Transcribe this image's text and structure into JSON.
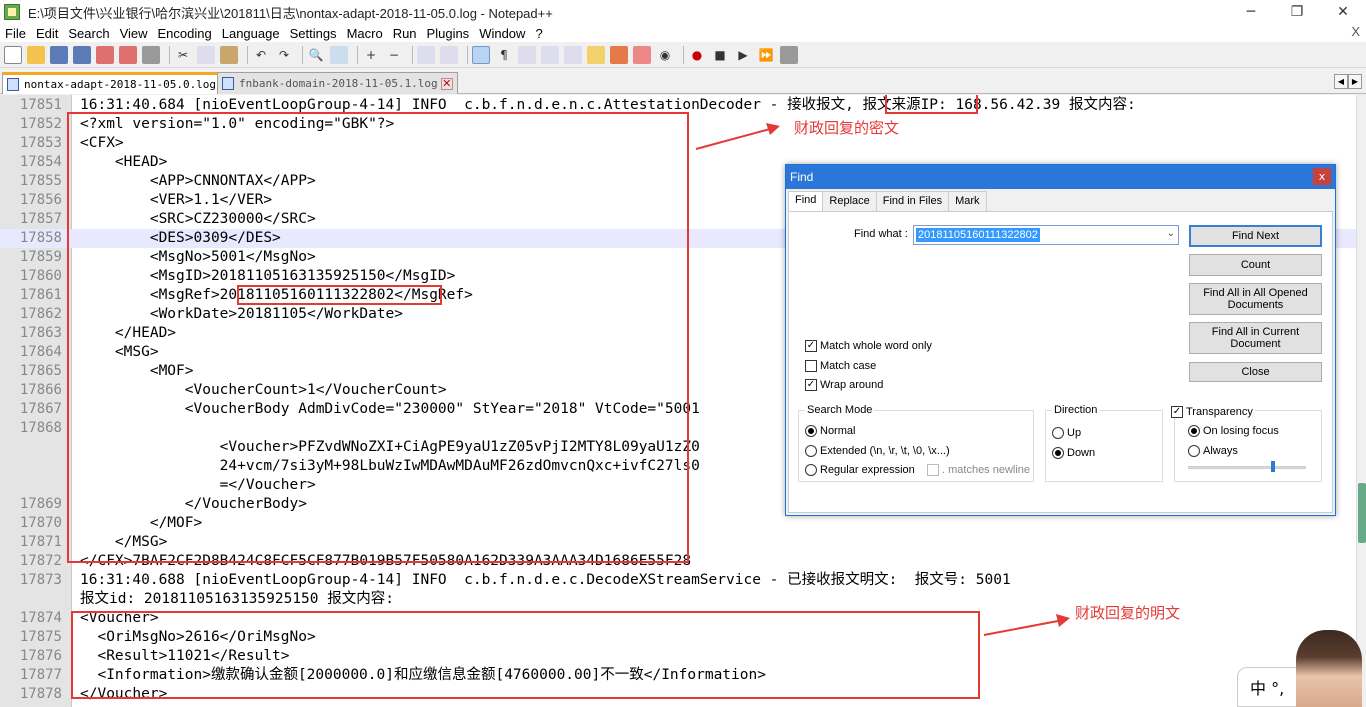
{
  "window": {
    "title": "E:\\项目文件\\兴业银行\\哈尔滨兴业\\201811\\日志\\nontax-adapt-2018-11-05.0.log - Notepad++",
    "minimize": "─",
    "maximize": "❐",
    "close": "✕"
  },
  "menu": {
    "items": [
      "File",
      "Edit",
      "Search",
      "View",
      "Encoding",
      "Language",
      "Settings",
      "Macro",
      "Run",
      "Plugins",
      "Window",
      "?"
    ],
    "close": "X"
  },
  "tabs": [
    {
      "label": "nontax-adapt-2018-11-05.0.log",
      "active": true
    },
    {
      "label": "fnbank-domain-2018-11-05.1.log",
      "active": false
    }
  ],
  "tab_arrows": {
    "left": "◀",
    "right": "▶"
  },
  "editor": {
    "lines": [
      {
        "num": "17851",
        "text": "16:31:40.684 [nioEventLoopGroup-4-14] INFO  c.b.f.n.d.e.n.c.AttestationDecoder - 接收报文, 报文来源IP: 168.56.42.39 报文内容:"
      },
      {
        "num": "17852",
        "text": "<?xml version=\"1.0\" encoding=\"GBK\"?>"
      },
      {
        "num": "17853",
        "text": "<CFX>"
      },
      {
        "num": "17854",
        "text": "    <HEAD>"
      },
      {
        "num": "17855",
        "text": "        <APP>CNNONTAX</APP>"
      },
      {
        "num": "17856",
        "text": "        <VER>1.1</VER>"
      },
      {
        "num": "17857",
        "text": "        <SRC>CZ230000</SRC>"
      },
      {
        "num": "17858",
        "text": "        <DES>0309</DES>"
      },
      {
        "num": "17859",
        "text": "        <MsgNo>5001</MsgNo>"
      },
      {
        "num": "17860",
        "text": "        <MsgID>20181105163135925150</MsgID>"
      },
      {
        "num": "17861",
        "text": "        <MsgRef>20181105160111322802</MsgRef>"
      },
      {
        "num": "17862",
        "text": "        <WorkDate>20181105</WorkDate>"
      },
      {
        "num": "17863",
        "text": "    </HEAD>"
      },
      {
        "num": "17864",
        "text": "    <MSG>"
      },
      {
        "num": "17865",
        "text": "        <MOF>"
      },
      {
        "num": "17866",
        "text": "            <VoucherCount>1</VoucherCount>"
      },
      {
        "num": "17867",
        "text": "            <VoucherBody AdmDivCode=\"230000\" StYear=\"2018\" VtCode=\"5001"
      },
      {
        "num": "17868",
        "text": ""
      },
      {
        "num": "",
        "text": "                <Voucher>PFZvdWNoZXI+CiAgPE9yaU1zZ05vPjI2MTY8L09yaU1zZ0"
      },
      {
        "num": "",
        "text": "                24+vcm/7si3yM+98LbuWzIwMDAwMDAuMF26zdOmvcnQxc+ivfC27ls0"
      },
      {
        "num": "",
        "text": "                =</Voucher>"
      },
      {
        "num": "17869",
        "text": "            </VoucherBody>"
      },
      {
        "num": "17870",
        "text": "        </MOF>"
      },
      {
        "num": "17871",
        "text": "    </MSG>"
      },
      {
        "num": "17872",
        "text": "</CFX>7BAF2CF2D8B424C8FCF5CF877B019B57F50580A162D339A3AAA34D1686E55F28"
      },
      {
        "num": "17873",
        "text": "16:31:40.688 [nioEventLoopGroup-4-14] INFO  c.b.f.n.d.e.c.DecodeXStreamService - 已接收报文明文:  报文号: 5001"
      },
      {
        "num": "",
        "text": "报文id: 20181105163135925150 报文内容:"
      },
      {
        "num": "17874",
        "text": "<Voucher>"
      },
      {
        "num": "17875",
        "text": "  <OriMsgNo>2616</OriMsgNo>"
      },
      {
        "num": "17876",
        "text": "  <Result>11021</Result>"
      },
      {
        "num": "17877",
        "text": "  <Information>缴款确认金额[2000000.0]和应缴信息金额[4760000.00]不一致</Information>"
      },
      {
        "num": "17878",
        "text": "</Voucher>"
      }
    ]
  },
  "annotations": {
    "cipher": "财政回复的密文",
    "plain": "财政回复的明文"
  },
  "find_dialog": {
    "title": "Find",
    "close": "x",
    "tabs": [
      "Find",
      "Replace",
      "Find in Files",
      "Mark"
    ],
    "find_what_label": "Find what :",
    "find_what_value": "20181105160111322802",
    "buttons": {
      "find_next": "Find Next",
      "count": "Count",
      "find_all_opened": "Find All in All Opened Documents",
      "find_all_current": "Find All in Current Document",
      "close": "Close"
    },
    "options": {
      "match_whole_word": {
        "label": "Match whole word only",
        "checked": true
      },
      "match_case": {
        "label": "Match case",
        "checked": false
      },
      "wrap_around": {
        "label": "Wrap around",
        "checked": true
      }
    },
    "search_mode": {
      "title": "Search Mode",
      "normal": "Normal",
      "extended": "Extended (\\n, \\r, \\t, \\0, \\x...)",
      "regex": "Regular expression",
      "matches_newline": ". matches newline",
      "selected": "Normal"
    },
    "direction": {
      "title": "Direction",
      "up": "Up",
      "down": "Down",
      "selected": "Down"
    },
    "transparency": {
      "title": "Transparency",
      "checked": true,
      "on_losing_focus": "On losing focus",
      "always": "Always",
      "selected": "On losing focus",
      "level": 0.72
    }
  },
  "ime": {
    "label": "中 °,"
  },
  "colors": {
    "annotation_red": "#e53935",
    "accent_blue": "#2b77d9",
    "selection_blue": "#3399ff"
  }
}
